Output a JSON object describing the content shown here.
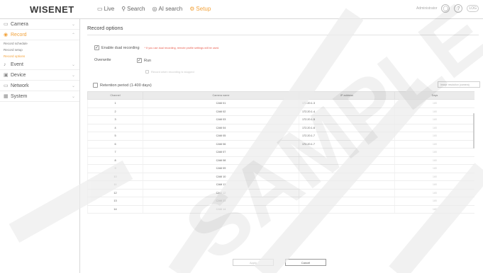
{
  "header": {
    "logo": "WISENET",
    "nav": [
      {
        "icon": "monitor-icon",
        "glyph": "▭",
        "label": "Live",
        "active": false
      },
      {
        "icon": "search-icon",
        "glyph": "⚲",
        "label": "Search",
        "active": false
      },
      {
        "icon": "ai-search-icon",
        "glyph": "◎",
        "label": "AI search",
        "active": false
      },
      {
        "icon": "gear-icon",
        "glyph": "⚙",
        "label": "Setup",
        "active": true
      }
    ],
    "user_text": "Administrator",
    "logout_label": "LOG"
  },
  "sidebar": {
    "items": [
      {
        "name": "camera",
        "glyph": "▭",
        "label": "Camera",
        "active": false
      },
      {
        "name": "record",
        "glyph": "◉",
        "label": "Record",
        "active": true
      },
      {
        "name": "event",
        "glyph": "♪",
        "label": "Event",
        "active": false
      },
      {
        "name": "device",
        "glyph": "▣",
        "label": "Device",
        "active": false
      },
      {
        "name": "network",
        "glyph": "▭",
        "label": "Network",
        "active": false
      },
      {
        "name": "system",
        "glyph": "▦",
        "label": "System",
        "active": false
      }
    ],
    "record_subitems": [
      {
        "label": "Record schedule",
        "active": false
      },
      {
        "label": "Record setup",
        "active": false
      },
      {
        "label": "Record options",
        "active": true
      }
    ]
  },
  "main": {
    "title": "Record options",
    "dual_recording_label": "Enable dual recording",
    "dual_recording_note": "* If you use dual recording, remote profile settings will be used.",
    "overwrite_label": "Overwrite",
    "run_label": "Run",
    "notify_label": "Record when recording is stopped",
    "retention_label": "Retention period (1-400 days)",
    "retention_combo": "Image resolution (camera)",
    "table": {
      "headers": [
        "Channel",
        "Camera name",
        "IP address",
        "Days"
      ],
      "rows": [
        {
          "channel": "1",
          "name": "CAM 01",
          "ip": "172.20.1.3",
          "days": "180"
        },
        {
          "channel": "2",
          "name": "CAM 02",
          "ip": "172.20.1.4",
          "days": "180"
        },
        {
          "channel": "3",
          "name": "CAM 03",
          "ip": "172.20.1.5",
          "days": "180"
        },
        {
          "channel": "4",
          "name": "CAM 04",
          "ip": "172.20.1.6",
          "days": "180"
        },
        {
          "channel": "5",
          "name": "CAM 05",
          "ip": "172.20.1.7",
          "days": "180"
        },
        {
          "channel": "6",
          "name": "CAM 06",
          "ip": "172.20.1.7",
          "days": "180"
        },
        {
          "channel": "7",
          "name": "CAM 07",
          "ip": "",
          "days": "180"
        },
        {
          "channel": "8",
          "name": "CAM 08",
          "ip": "",
          "days": "180"
        },
        {
          "channel": "9",
          "name": "CAM 09",
          "ip": "",
          "days": "180"
        },
        {
          "channel": "10",
          "name": "CAM 10",
          "ip": "",
          "days": "180"
        },
        {
          "channel": "11",
          "name": "CAM 11",
          "ip": "",
          "days": "180"
        },
        {
          "channel": "12",
          "name": "CAM 12",
          "ip": "",
          "days": "180"
        },
        {
          "channel": "13",
          "name": "CAM 13",
          "ip": "",
          "days": "180"
        },
        {
          "channel": "14",
          "name": "CAM 14",
          "ip": "",
          "days": "180"
        }
      ]
    },
    "apply_label": "Apply",
    "cancel_label": "Cancel"
  },
  "watermark": "SAMPLE",
  "colors": {
    "accent": "#f2a23a",
    "note": "#e8594a"
  }
}
